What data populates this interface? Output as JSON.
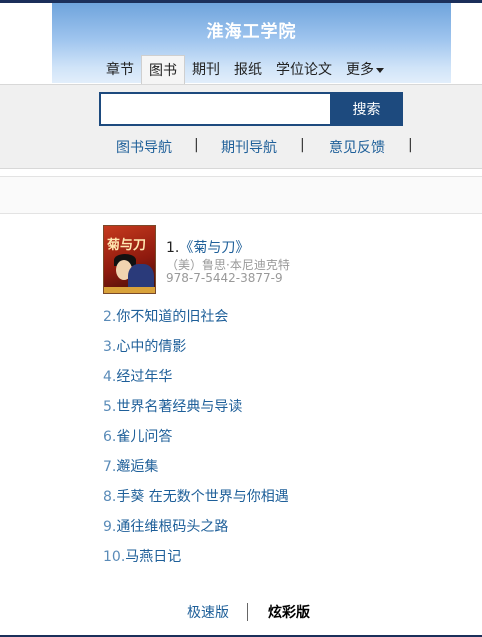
{
  "header": {
    "school": "淮海工学院",
    "tabs": [
      {
        "label": "章节"
      },
      {
        "label": "图书",
        "active": true
      },
      {
        "label": "期刊"
      },
      {
        "label": "报纸"
      },
      {
        "label": "学位论文"
      },
      {
        "label": "更多"
      }
    ]
  },
  "search": {
    "value": "",
    "button": "搜索"
  },
  "subnav": {
    "items": [
      "图书导航",
      "期刊导航",
      "意见反馈"
    ],
    "separator": "|"
  },
  "ranking": {
    "first": {
      "number": "1.",
      "title": "《菊与刀》",
      "author": "（美）鲁思·本尼迪克特",
      "isbn": "978-7-5442-3877-9",
      "cover_text": "菊与刀"
    },
    "others": [
      {
        "number": "2.",
        "title": "你不知道的旧社会"
      },
      {
        "number": "3.",
        "title": "心中的倩影"
      },
      {
        "number": "4.",
        "title": "经过年华"
      },
      {
        "number": "5.",
        "title": "世界名著经典与导读"
      },
      {
        "number": "6.",
        "title": "雀儿问答"
      },
      {
        "number": "7.",
        "title": "邂逅集"
      },
      {
        "number": "8.",
        "title": "手葵 在无数个世界与你相遇"
      },
      {
        "number": "9.",
        "title": "通往维根码头之路"
      },
      {
        "number": "10.",
        "title": "马燕日记"
      }
    ]
  },
  "footer": {
    "speed": "极速版",
    "fancy": "炫彩版"
  },
  "colors": {
    "link": "#1e5f99",
    "search_button": "#1d4a7e",
    "header_top": "#6fa4dc"
  }
}
